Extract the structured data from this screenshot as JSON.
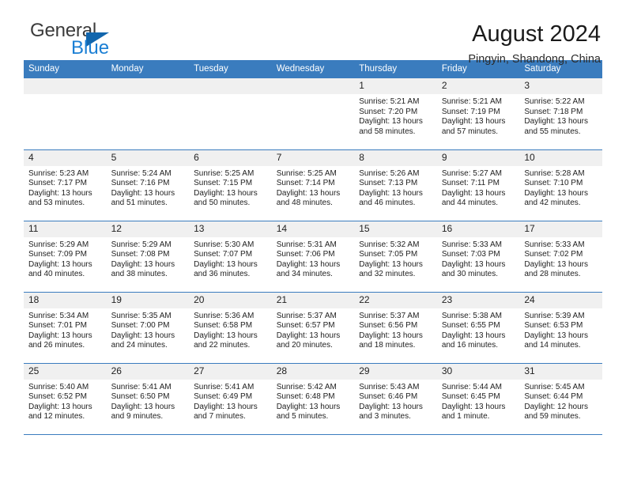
{
  "brand": {
    "name_part1": "General",
    "name_part2": "Blue",
    "triangle_color": "#1266ad",
    "blue_color": "#1b7fd4"
  },
  "header": {
    "title": "August 2024",
    "subtitle": "Pingyin, Shandong, China"
  },
  "theme": {
    "header_bg": "#3a7cbe",
    "daynum_bg": "#f0f0f0",
    "grid_line": "#3a7cbe"
  },
  "weekdays": [
    "Sunday",
    "Monday",
    "Tuesday",
    "Wednesday",
    "Thursday",
    "Friday",
    "Saturday"
  ],
  "labels": {
    "sunrise": "Sunrise:",
    "sunset": "Sunset:",
    "daylight": "Daylight:"
  },
  "weeks": [
    [
      {
        "day": "",
        "sunrise": "",
        "sunset": "",
        "daylight": ""
      },
      {
        "day": "",
        "sunrise": "",
        "sunset": "",
        "daylight": ""
      },
      {
        "day": "",
        "sunrise": "",
        "sunset": "",
        "daylight": ""
      },
      {
        "day": "",
        "sunrise": "",
        "sunset": "",
        "daylight": ""
      },
      {
        "day": "1",
        "sunrise": "Sunrise: 5:21 AM",
        "sunset": "Sunset: 7:20 PM",
        "daylight": "Daylight: 13 hours and 58 minutes."
      },
      {
        "day": "2",
        "sunrise": "Sunrise: 5:21 AM",
        "sunset": "Sunset: 7:19 PM",
        "daylight": "Daylight: 13 hours and 57 minutes."
      },
      {
        "day": "3",
        "sunrise": "Sunrise: 5:22 AM",
        "sunset": "Sunset: 7:18 PM",
        "daylight": "Daylight: 13 hours and 55 minutes."
      }
    ],
    [
      {
        "day": "4",
        "sunrise": "Sunrise: 5:23 AM",
        "sunset": "Sunset: 7:17 PM",
        "daylight": "Daylight: 13 hours and 53 minutes."
      },
      {
        "day": "5",
        "sunrise": "Sunrise: 5:24 AM",
        "sunset": "Sunset: 7:16 PM",
        "daylight": "Daylight: 13 hours and 51 minutes."
      },
      {
        "day": "6",
        "sunrise": "Sunrise: 5:25 AM",
        "sunset": "Sunset: 7:15 PM",
        "daylight": "Daylight: 13 hours and 50 minutes."
      },
      {
        "day": "7",
        "sunrise": "Sunrise: 5:25 AM",
        "sunset": "Sunset: 7:14 PM",
        "daylight": "Daylight: 13 hours and 48 minutes."
      },
      {
        "day": "8",
        "sunrise": "Sunrise: 5:26 AM",
        "sunset": "Sunset: 7:13 PM",
        "daylight": "Daylight: 13 hours and 46 minutes."
      },
      {
        "day": "9",
        "sunrise": "Sunrise: 5:27 AM",
        "sunset": "Sunset: 7:11 PM",
        "daylight": "Daylight: 13 hours and 44 minutes."
      },
      {
        "day": "10",
        "sunrise": "Sunrise: 5:28 AM",
        "sunset": "Sunset: 7:10 PM",
        "daylight": "Daylight: 13 hours and 42 minutes."
      }
    ],
    [
      {
        "day": "11",
        "sunrise": "Sunrise: 5:29 AM",
        "sunset": "Sunset: 7:09 PM",
        "daylight": "Daylight: 13 hours and 40 minutes."
      },
      {
        "day": "12",
        "sunrise": "Sunrise: 5:29 AM",
        "sunset": "Sunset: 7:08 PM",
        "daylight": "Daylight: 13 hours and 38 minutes."
      },
      {
        "day": "13",
        "sunrise": "Sunrise: 5:30 AM",
        "sunset": "Sunset: 7:07 PM",
        "daylight": "Daylight: 13 hours and 36 minutes."
      },
      {
        "day": "14",
        "sunrise": "Sunrise: 5:31 AM",
        "sunset": "Sunset: 7:06 PM",
        "daylight": "Daylight: 13 hours and 34 minutes."
      },
      {
        "day": "15",
        "sunrise": "Sunrise: 5:32 AM",
        "sunset": "Sunset: 7:05 PM",
        "daylight": "Daylight: 13 hours and 32 minutes."
      },
      {
        "day": "16",
        "sunrise": "Sunrise: 5:33 AM",
        "sunset": "Sunset: 7:03 PM",
        "daylight": "Daylight: 13 hours and 30 minutes."
      },
      {
        "day": "17",
        "sunrise": "Sunrise: 5:33 AM",
        "sunset": "Sunset: 7:02 PM",
        "daylight": "Daylight: 13 hours and 28 minutes."
      }
    ],
    [
      {
        "day": "18",
        "sunrise": "Sunrise: 5:34 AM",
        "sunset": "Sunset: 7:01 PM",
        "daylight": "Daylight: 13 hours and 26 minutes."
      },
      {
        "day": "19",
        "sunrise": "Sunrise: 5:35 AM",
        "sunset": "Sunset: 7:00 PM",
        "daylight": "Daylight: 13 hours and 24 minutes."
      },
      {
        "day": "20",
        "sunrise": "Sunrise: 5:36 AM",
        "sunset": "Sunset: 6:58 PM",
        "daylight": "Daylight: 13 hours and 22 minutes."
      },
      {
        "day": "21",
        "sunrise": "Sunrise: 5:37 AM",
        "sunset": "Sunset: 6:57 PM",
        "daylight": "Daylight: 13 hours and 20 minutes."
      },
      {
        "day": "22",
        "sunrise": "Sunrise: 5:37 AM",
        "sunset": "Sunset: 6:56 PM",
        "daylight": "Daylight: 13 hours and 18 minutes."
      },
      {
        "day": "23",
        "sunrise": "Sunrise: 5:38 AM",
        "sunset": "Sunset: 6:55 PM",
        "daylight": "Daylight: 13 hours and 16 minutes."
      },
      {
        "day": "24",
        "sunrise": "Sunrise: 5:39 AM",
        "sunset": "Sunset: 6:53 PM",
        "daylight": "Daylight: 13 hours and 14 minutes."
      }
    ],
    [
      {
        "day": "25",
        "sunrise": "Sunrise: 5:40 AM",
        "sunset": "Sunset: 6:52 PM",
        "daylight": "Daylight: 13 hours and 12 minutes."
      },
      {
        "day": "26",
        "sunrise": "Sunrise: 5:41 AM",
        "sunset": "Sunset: 6:50 PM",
        "daylight": "Daylight: 13 hours and 9 minutes."
      },
      {
        "day": "27",
        "sunrise": "Sunrise: 5:41 AM",
        "sunset": "Sunset: 6:49 PM",
        "daylight": "Daylight: 13 hours and 7 minutes."
      },
      {
        "day": "28",
        "sunrise": "Sunrise: 5:42 AM",
        "sunset": "Sunset: 6:48 PM",
        "daylight": "Daylight: 13 hours and 5 minutes."
      },
      {
        "day": "29",
        "sunrise": "Sunrise: 5:43 AM",
        "sunset": "Sunset: 6:46 PM",
        "daylight": "Daylight: 13 hours and 3 minutes."
      },
      {
        "day": "30",
        "sunrise": "Sunrise: 5:44 AM",
        "sunset": "Sunset: 6:45 PM",
        "daylight": "Daylight: 13 hours and 1 minute."
      },
      {
        "day": "31",
        "sunrise": "Sunrise: 5:45 AM",
        "sunset": "Sunset: 6:44 PM",
        "daylight": "Daylight: 12 hours and 59 minutes."
      }
    ]
  ]
}
